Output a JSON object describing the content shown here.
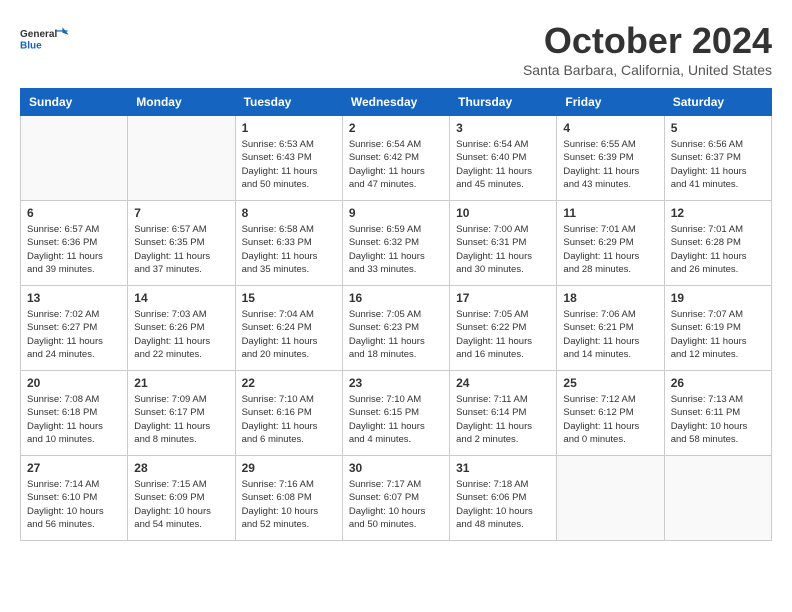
{
  "logo": {
    "line1": "General",
    "line2": "Blue"
  },
  "title": "October 2024",
  "location": "Santa Barbara, California, United States",
  "weekdays": [
    "Sunday",
    "Monday",
    "Tuesday",
    "Wednesday",
    "Thursday",
    "Friday",
    "Saturday"
  ],
  "weeks": [
    [
      {
        "day": "",
        "sunrise": "",
        "sunset": "",
        "daylight": ""
      },
      {
        "day": "",
        "sunrise": "",
        "sunset": "",
        "daylight": ""
      },
      {
        "day": "1",
        "sunrise": "Sunrise: 6:53 AM",
        "sunset": "Sunset: 6:43 PM",
        "daylight": "Daylight: 11 hours and 50 minutes."
      },
      {
        "day": "2",
        "sunrise": "Sunrise: 6:54 AM",
        "sunset": "Sunset: 6:42 PM",
        "daylight": "Daylight: 11 hours and 47 minutes."
      },
      {
        "day": "3",
        "sunrise": "Sunrise: 6:54 AM",
        "sunset": "Sunset: 6:40 PM",
        "daylight": "Daylight: 11 hours and 45 minutes."
      },
      {
        "day": "4",
        "sunrise": "Sunrise: 6:55 AM",
        "sunset": "Sunset: 6:39 PM",
        "daylight": "Daylight: 11 hours and 43 minutes."
      },
      {
        "day": "5",
        "sunrise": "Sunrise: 6:56 AM",
        "sunset": "Sunset: 6:37 PM",
        "daylight": "Daylight: 11 hours and 41 minutes."
      }
    ],
    [
      {
        "day": "6",
        "sunrise": "Sunrise: 6:57 AM",
        "sunset": "Sunset: 6:36 PM",
        "daylight": "Daylight: 11 hours and 39 minutes."
      },
      {
        "day": "7",
        "sunrise": "Sunrise: 6:57 AM",
        "sunset": "Sunset: 6:35 PM",
        "daylight": "Daylight: 11 hours and 37 minutes."
      },
      {
        "day": "8",
        "sunrise": "Sunrise: 6:58 AM",
        "sunset": "Sunset: 6:33 PM",
        "daylight": "Daylight: 11 hours and 35 minutes."
      },
      {
        "day": "9",
        "sunrise": "Sunrise: 6:59 AM",
        "sunset": "Sunset: 6:32 PM",
        "daylight": "Daylight: 11 hours and 33 minutes."
      },
      {
        "day": "10",
        "sunrise": "Sunrise: 7:00 AM",
        "sunset": "Sunset: 6:31 PM",
        "daylight": "Daylight: 11 hours and 30 minutes."
      },
      {
        "day": "11",
        "sunrise": "Sunrise: 7:01 AM",
        "sunset": "Sunset: 6:29 PM",
        "daylight": "Daylight: 11 hours and 28 minutes."
      },
      {
        "day": "12",
        "sunrise": "Sunrise: 7:01 AM",
        "sunset": "Sunset: 6:28 PM",
        "daylight": "Daylight: 11 hours and 26 minutes."
      }
    ],
    [
      {
        "day": "13",
        "sunrise": "Sunrise: 7:02 AM",
        "sunset": "Sunset: 6:27 PM",
        "daylight": "Daylight: 11 hours and 24 minutes."
      },
      {
        "day": "14",
        "sunrise": "Sunrise: 7:03 AM",
        "sunset": "Sunset: 6:26 PM",
        "daylight": "Daylight: 11 hours and 22 minutes."
      },
      {
        "day": "15",
        "sunrise": "Sunrise: 7:04 AM",
        "sunset": "Sunset: 6:24 PM",
        "daylight": "Daylight: 11 hours and 20 minutes."
      },
      {
        "day": "16",
        "sunrise": "Sunrise: 7:05 AM",
        "sunset": "Sunset: 6:23 PM",
        "daylight": "Daylight: 11 hours and 18 minutes."
      },
      {
        "day": "17",
        "sunrise": "Sunrise: 7:05 AM",
        "sunset": "Sunset: 6:22 PM",
        "daylight": "Daylight: 11 hours and 16 minutes."
      },
      {
        "day": "18",
        "sunrise": "Sunrise: 7:06 AM",
        "sunset": "Sunset: 6:21 PM",
        "daylight": "Daylight: 11 hours and 14 minutes."
      },
      {
        "day": "19",
        "sunrise": "Sunrise: 7:07 AM",
        "sunset": "Sunset: 6:19 PM",
        "daylight": "Daylight: 11 hours and 12 minutes."
      }
    ],
    [
      {
        "day": "20",
        "sunrise": "Sunrise: 7:08 AM",
        "sunset": "Sunset: 6:18 PM",
        "daylight": "Daylight: 11 hours and 10 minutes."
      },
      {
        "day": "21",
        "sunrise": "Sunrise: 7:09 AM",
        "sunset": "Sunset: 6:17 PM",
        "daylight": "Daylight: 11 hours and 8 minutes."
      },
      {
        "day": "22",
        "sunrise": "Sunrise: 7:10 AM",
        "sunset": "Sunset: 6:16 PM",
        "daylight": "Daylight: 11 hours and 6 minutes."
      },
      {
        "day": "23",
        "sunrise": "Sunrise: 7:10 AM",
        "sunset": "Sunset: 6:15 PM",
        "daylight": "Daylight: 11 hours and 4 minutes."
      },
      {
        "day": "24",
        "sunrise": "Sunrise: 7:11 AM",
        "sunset": "Sunset: 6:14 PM",
        "daylight": "Daylight: 11 hours and 2 minutes."
      },
      {
        "day": "25",
        "sunrise": "Sunrise: 7:12 AM",
        "sunset": "Sunset: 6:12 PM",
        "daylight": "Daylight: 11 hours and 0 minutes."
      },
      {
        "day": "26",
        "sunrise": "Sunrise: 7:13 AM",
        "sunset": "Sunset: 6:11 PM",
        "daylight": "Daylight: 10 hours and 58 minutes."
      }
    ],
    [
      {
        "day": "27",
        "sunrise": "Sunrise: 7:14 AM",
        "sunset": "Sunset: 6:10 PM",
        "daylight": "Daylight: 10 hours and 56 minutes."
      },
      {
        "day": "28",
        "sunrise": "Sunrise: 7:15 AM",
        "sunset": "Sunset: 6:09 PM",
        "daylight": "Daylight: 10 hours and 54 minutes."
      },
      {
        "day": "29",
        "sunrise": "Sunrise: 7:16 AM",
        "sunset": "Sunset: 6:08 PM",
        "daylight": "Daylight: 10 hours and 52 minutes."
      },
      {
        "day": "30",
        "sunrise": "Sunrise: 7:17 AM",
        "sunset": "Sunset: 6:07 PM",
        "daylight": "Daylight: 10 hours and 50 minutes."
      },
      {
        "day": "31",
        "sunrise": "Sunrise: 7:18 AM",
        "sunset": "Sunset: 6:06 PM",
        "daylight": "Daylight: 10 hours and 48 minutes."
      },
      {
        "day": "",
        "sunrise": "",
        "sunset": "",
        "daylight": ""
      },
      {
        "day": "",
        "sunrise": "",
        "sunset": "",
        "daylight": ""
      }
    ]
  ]
}
